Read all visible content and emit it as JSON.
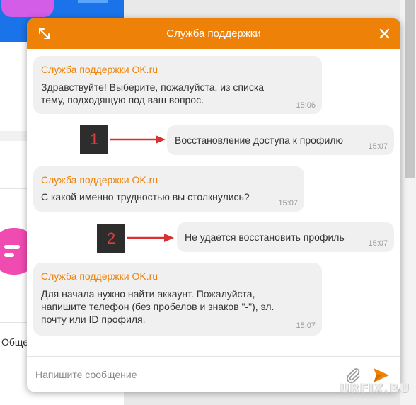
{
  "chat": {
    "title": "Служба поддержки",
    "input_placeholder": "Напишите сообщение",
    "accent_color": "#ee8208",
    "messages": [
      {
        "from": "support",
        "sender": "Служба поддержки OK.ru",
        "lines": [
          "Здравствуйте! Выберите, пожалуйста, из списка",
          "тему, подходящую под ваш вопрос."
        ],
        "time": "15:06"
      },
      {
        "from": "user",
        "text": "Восстановление доступа к профилю",
        "time": "15:07",
        "annotation": "1"
      },
      {
        "from": "support",
        "sender": "Служба поддержки OK.ru",
        "lines": [
          "С какой именно трудностью вы столкнулись?"
        ],
        "time": "15:07"
      },
      {
        "from": "user",
        "text": "Не удается восстановить профиль",
        "time": "15:07",
        "annotation": "2"
      },
      {
        "from": "support",
        "sender": "Служба поддержки OK.ru",
        "lines": [
          "Для начала нужно найти аккаунт. Пожалуйста,",
          "напишите телефон (без пробелов и знаков \"-\"), эл.",
          "почту или ID профиля."
        ],
        "time": "15:07"
      }
    ]
  },
  "background": {
    "partial_text": "Обще"
  },
  "icons": [
    "expand-icon",
    "close-icon",
    "paperclip-icon",
    "send-icon"
  ],
  "watermark": "URFIX.RU"
}
